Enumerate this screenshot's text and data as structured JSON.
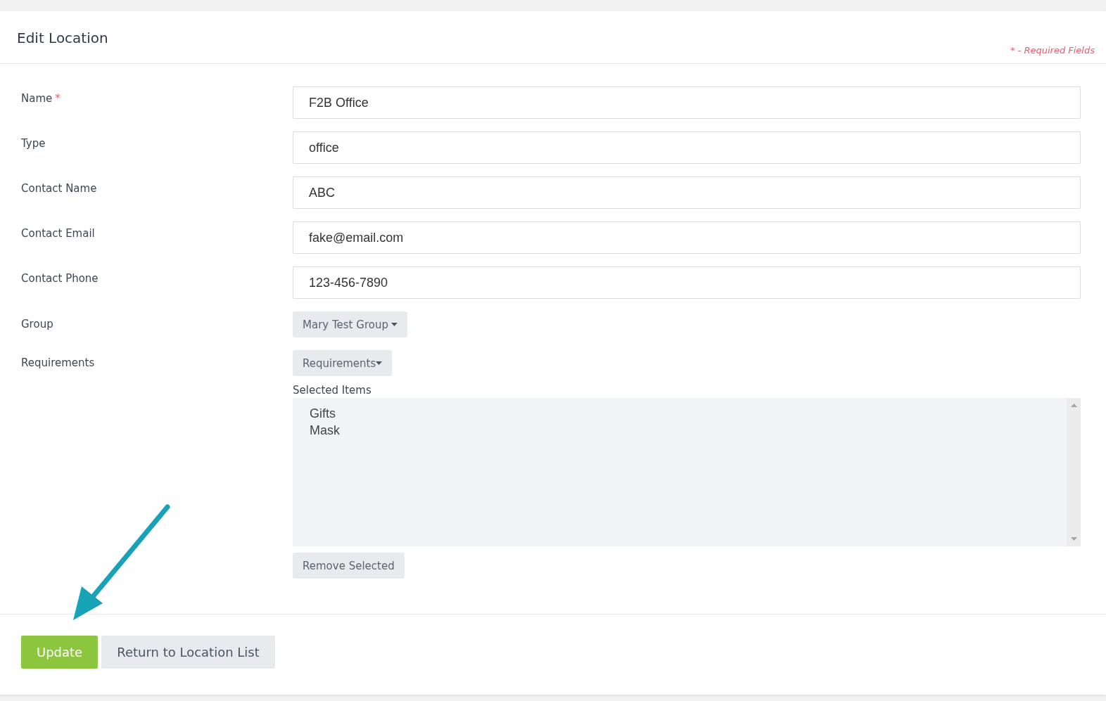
{
  "header": {
    "title": "Edit Location",
    "legend": "* - Required Fields"
  },
  "fields": [
    {
      "kind": "text",
      "label": "Name",
      "required_mark": "*",
      "value": "F2B Office"
    },
    {
      "kind": "text",
      "label": "Type",
      "value": "office"
    },
    {
      "kind": "text",
      "label": "Contact Name",
      "value": "ABC"
    },
    {
      "kind": "text",
      "label": "Contact Email",
      "value": "fake@email.com"
    },
    {
      "kind": "text",
      "label": "Contact Phone",
      "value": "123-456-7890"
    },
    {
      "kind": "dropdown",
      "label": "Group",
      "value": "Mary Test Group"
    },
    {
      "kind": "multiselect",
      "label": "Requirements",
      "value": "Requirements",
      "selected_label": "Selected Items",
      "selected_items": [
        "Gifts",
        "Mask"
      ],
      "remove_button": "Remove Selected"
    }
  ],
  "buttons": [
    {
      "kind": "primary",
      "label": "Update"
    },
    {
      "kind": "secondary",
      "label": "Return to Location List"
    }
  ]
}
